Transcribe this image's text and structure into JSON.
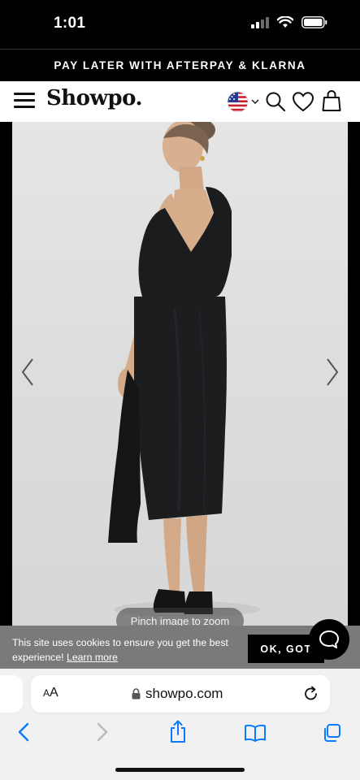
{
  "status_bar": {
    "time": "1:01"
  },
  "promo": {
    "text": "PAY LATER WITH AFTERPAY & KLARNA"
  },
  "header": {
    "logo": "Showpo."
  },
  "product": {
    "zoom_hint": "Pinch image to zoom"
  },
  "cookie": {
    "text": "This site uses cookies to ensure you get the best experience!",
    "learn_more": "Learn more",
    "ok_label": "OK, GOT"
  },
  "browser": {
    "aa_large": "A",
    "aa_small": "A",
    "url": "showpo.com"
  },
  "colors": {
    "accent": "#0a7aff",
    "dress": "#1a1b1d"
  }
}
